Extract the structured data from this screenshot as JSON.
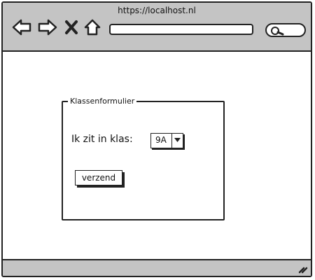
{
  "browser": {
    "url": "https://localhost.nl",
    "address_value": "",
    "icons": [
      "back-arrow-icon",
      "forward-arrow-icon",
      "close-icon",
      "home-icon",
      "search-icon",
      "resize-grip-icon"
    ]
  },
  "form": {
    "legend": "Klassenformulier",
    "class_label": "Ik zit in klas:",
    "class_selected": "9A",
    "submit_label": "verzend"
  }
}
